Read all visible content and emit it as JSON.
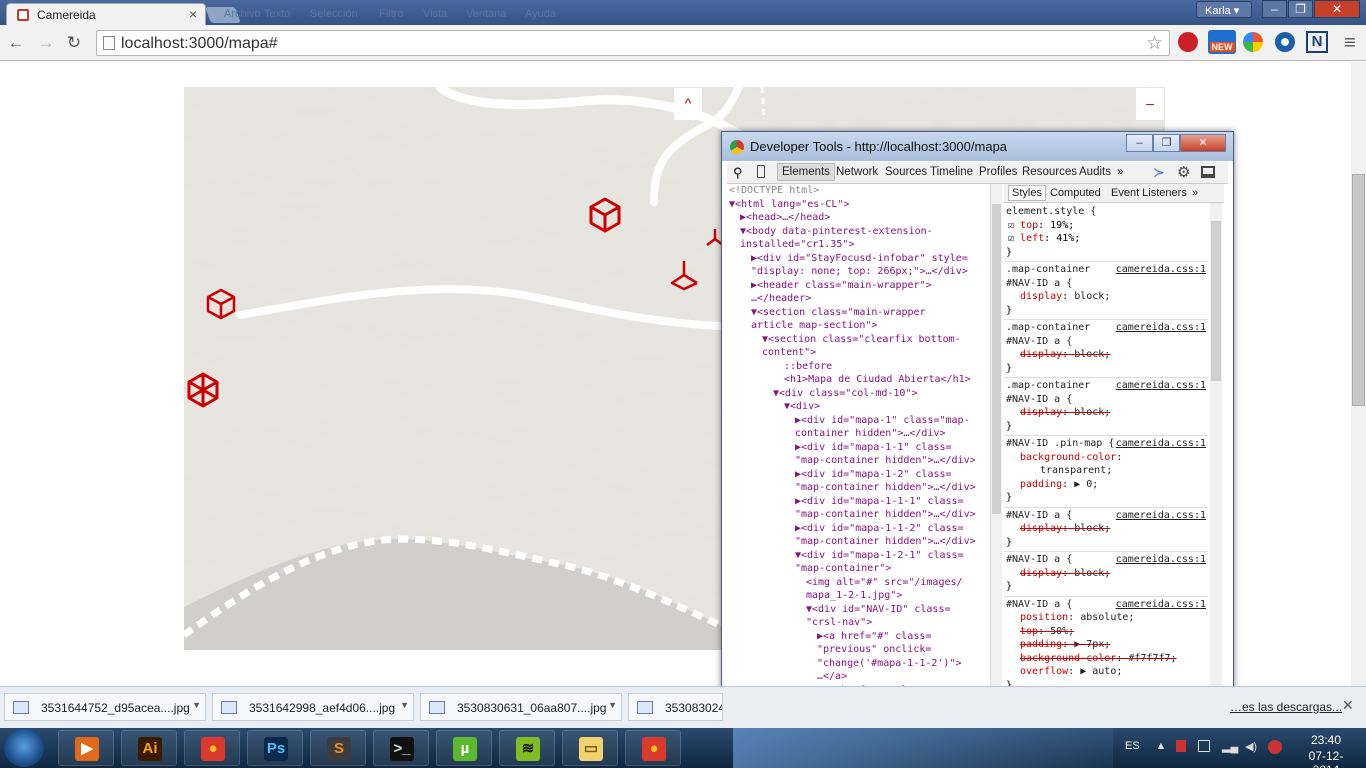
{
  "browser": {
    "tab_title": "Camereida",
    "tab_close": "×",
    "menu_ghost": [
      "Archivo",
      "Editar",
      "Texto",
      "Selección",
      "Filtro",
      "Vista",
      "Ventana",
      "Ayuda"
    ],
    "user": "Karla",
    "user_arrow": "▾",
    "win_min": "–",
    "win_max": "❐",
    "win_close": "✕",
    "nav_back": "←",
    "nav_forward": "→",
    "nav_reload": "↻",
    "url": "localhost:3000/mapa#",
    "star": "☆",
    "menu": "≡",
    "ext_new_label": "NEW",
    "ext_n_label": "N"
  },
  "map": {
    "btn_up": "^",
    "btn_minus": "–"
  },
  "devtools": {
    "title": "Developer Tools - http://localhost:3000/mapa",
    "tabs": [
      "Elements",
      "Network",
      "Sources",
      "Timeline",
      "Profiles",
      "Resources",
      "Audits"
    ],
    "tabs_more": "»",
    "styles_tabs": [
      "Styles",
      "Computed",
      "Event Listeners"
    ],
    "styles_more": "»",
    "element_style": {
      "selector": "element.style {",
      "props": [
        {
          "name": "top",
          "value": "19%;"
        },
        {
          "name": "left",
          "value": "41%;"
        }
      ]
    },
    "rules": [
      {
        "sel1": ".map-container",
        "sel2": "#NAV-ID a {",
        "src": "camereida.css:1",
        "props": [
          {
            "name": "display",
            "value": "block;",
            "struck": false
          }
        ]
      },
      {
        "sel1": ".map-container",
        "sel2": "#NAV-ID a {",
        "src": "camereida.css:1",
        "props": [
          {
            "name": "display",
            "value": "block;",
            "struck": true
          }
        ]
      },
      {
        "sel1": ".map-container",
        "sel2": "#NAV-ID a {",
        "src": "camereida.css:1",
        "props": [
          {
            "name": "display",
            "value": "block;",
            "struck": true
          }
        ]
      },
      {
        "sel1": "#NAV-ID .pin-map {",
        "sel2": "",
        "src": "camereida.css:1",
        "props": [
          {
            "name": "background-color",
            "value": "",
            "struck": false
          },
          {
            "name": "",
            "value": "transparent;",
            "struck": false
          },
          {
            "name": "padding",
            "value": "▶ 0;",
            "struck": false
          }
        ]
      },
      {
        "sel1": "#NAV-ID a {",
        "sel2": "",
        "src": "camereida.css:1",
        "props": [
          {
            "name": "display",
            "value": "block;",
            "struck": true
          }
        ]
      },
      {
        "sel1": "#NAV-ID a {",
        "sel2": "",
        "src": "camereida.css:1",
        "props": [
          {
            "name": "display",
            "value": "block;",
            "struck": true
          }
        ]
      },
      {
        "sel1": "#NAV-ID a {",
        "sel2": "",
        "src": "camereida.css:1",
        "props": [
          {
            "name": "position",
            "value": "absolute;",
            "struck": false
          },
          {
            "name": "top",
            "value": "50%;",
            "struck": true
          },
          {
            "name": "padding",
            "value": "▶ 7px;",
            "struck": true
          },
          {
            "name": "background-color",
            "value": "#f7f7f7;",
            "struck": true
          },
          {
            "name": "overflow",
            "value": "▶ auto;",
            "struck": false
          }
        ]
      },
      {
        "sel1": "#NAV-ID a {",
        "sel2": "",
        "src": "camereida.css:1",
        "props": []
      }
    ],
    "dom_lines": [
      {
        "i": 0,
        "t": "<!DOCTYPE html>",
        "k": "c"
      },
      {
        "i": 0,
        "t": "▼<html lang=\"es-CL\">",
        "k": "tag"
      },
      {
        "i": 1,
        "t": "▶<head>…</head>",
        "k": "tag"
      },
      {
        "i": 1,
        "t": "▼<body data-pinterest-extension-",
        "k": "tag"
      },
      {
        "i": 1,
        "t": "installed=\"cr1.35\">",
        "k": "tag"
      },
      {
        "i": 2,
        "t": "▶<div id=\"StayFocusd-infobar\" style=",
        "k": "tag"
      },
      {
        "i": 2,
        "t": "\"display: none; top: 266px;\">…</div>",
        "k": "tag"
      },
      {
        "i": 2,
        "t": "▶<header class=\"main-wrapper\">",
        "k": "tag"
      },
      {
        "i": 2,
        "t": "…</header>",
        "k": "tag"
      },
      {
        "i": 2,
        "t": "▼<section class=\"main-wrapper",
        "k": "tag"
      },
      {
        "i": 2,
        "t": "article map-section\">",
        "k": "tag"
      },
      {
        "i": 3,
        "t": "▼<section class=\"clearfix bottom-",
        "k": "tag"
      },
      {
        "i": 3,
        "t": "content\">",
        "k": "tag"
      },
      {
        "i": 5,
        "t": "::before",
        "k": "tag"
      },
      {
        "i": 5,
        "t": "<h1>Mapa de Ciudad Abierta</h1>",
        "k": "tag"
      },
      {
        "i": 4,
        "t": "▼<div class=\"col-md-10\">",
        "k": "tag"
      },
      {
        "i": 5,
        "t": "▼<div>",
        "k": "tag"
      },
      {
        "i": 6,
        "t": "▶<div id=\"mapa-1\" class=\"map-",
        "k": "tag"
      },
      {
        "i": 6,
        "t": "container hidden\">…</div>",
        "k": "tag"
      },
      {
        "i": 6,
        "t": "▶<div id=\"mapa-1-1\" class=",
        "k": "tag"
      },
      {
        "i": 6,
        "t": "\"map-container hidden\">…</div>",
        "k": "tag"
      },
      {
        "i": 6,
        "t": "▶<div id=\"mapa-1-2\" class=",
        "k": "tag"
      },
      {
        "i": 6,
        "t": "\"map-container hidden\">…</div>",
        "k": "tag"
      },
      {
        "i": 6,
        "t": "▶<div id=\"mapa-1-1-1\" class=",
        "k": "tag"
      },
      {
        "i": 6,
        "t": "\"map-container hidden\">…</div>",
        "k": "tag"
      },
      {
        "i": 6,
        "t": "▶<div id=\"mapa-1-1-2\" class=",
        "k": "tag"
      },
      {
        "i": 6,
        "t": "\"map-container hidden\">…</div>",
        "k": "tag"
      },
      {
        "i": 6,
        "t": "▼<div id=\"mapa-1-2-1\" class=",
        "k": "tag"
      },
      {
        "i": 6,
        "t": "\"map-container\">",
        "k": "tag"
      },
      {
        "i": 7,
        "t": "<img alt=\"#\" src=\"/images/",
        "k": "tag"
      },
      {
        "i": 7,
        "t": "mapa_1-2-1.jpg\">",
        "k": "tag"
      },
      {
        "i": 7,
        "t": "▼<div id=\"NAV-ID\" class=",
        "k": "tag"
      },
      {
        "i": 7,
        "t": "\"crsl-nav\">",
        "k": "tag"
      },
      {
        "i": 8,
        "t": "▶<a href=\"#\" class=",
        "k": "tag"
      },
      {
        "i": 8,
        "t": "\"previous\" onclick=",
        "k": "tag"
      },
      {
        "i": 8,
        "t": "\"change('#mapa-1-1-2')\">",
        "k": "tag"
      },
      {
        "i": 8,
        "t": "…</a>",
        "k": "tag"
      },
      {
        "i": 8,
        "t": "▶<a href=\"#\" class=\"top\"",
        "k": "tag"
      },
      {
        "i": 8,
        "t": "onclick=\"change('#mapa-1-",
        "k": "tag"
      },
      {
        "i": 8,
        "t": "2-2')\">…</a>",
        "k": "tag"
      }
    ]
  },
  "downloads": {
    "items": [
      "3531644752_d95acea....jpg",
      "3531642998_aef4d06....jpg",
      "3530830631_06aa807....jpg",
      "3530830241"
    ],
    "show_all": "…es las descargas...",
    "close": "✕"
  },
  "taskbar": {
    "apps": [
      {
        "name": "media-player",
        "glyph": "▶",
        "fg": "#fff",
        "bg": "#e06a1a"
      },
      {
        "name": "illustrator",
        "glyph": "Ai",
        "fg": "#f7a21b",
        "bg": "#3a1a00"
      },
      {
        "name": "chrome",
        "glyph": "●",
        "fg": "#f6c21c",
        "bg": "#d93a2b"
      },
      {
        "name": "photoshop",
        "glyph": "Ps",
        "fg": "#4fc0ff",
        "bg": "#0b2a4a"
      },
      {
        "name": "sublime-text",
        "glyph": "S",
        "fg": "#f28c1b",
        "bg": "#3c3c3c"
      },
      {
        "name": "command-prompt",
        "glyph": ">_",
        "fg": "#ddd",
        "bg": "#111"
      },
      {
        "name": "utorrent",
        "glyph": "µ",
        "fg": "#fff",
        "bg": "#5cb82e"
      },
      {
        "name": "spotify",
        "glyph": "≋",
        "fg": "#111",
        "bg": "#82bc24"
      },
      {
        "name": "file-explorer",
        "glyph": "▭",
        "fg": "#7a5a10",
        "bg": "#f2d270"
      },
      {
        "name": "chrome-devtools",
        "glyph": "●",
        "fg": "#f6c21c",
        "bg": "#d93a2b"
      }
    ],
    "lang": "ES",
    "time": "23:40",
    "date": "07-12-2014"
  }
}
